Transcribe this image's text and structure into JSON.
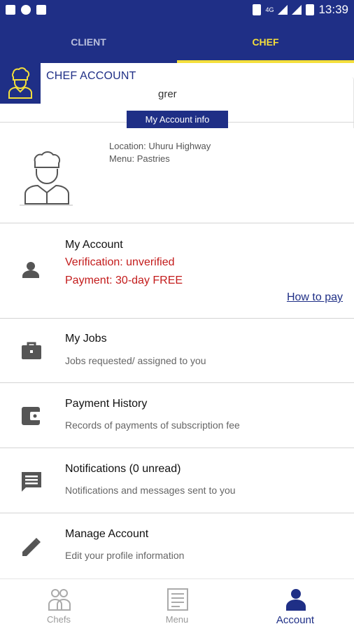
{
  "status_bar": {
    "time": "13:39",
    "network": "4G"
  },
  "tabs": [
    {
      "label": "CLIENT",
      "active": false
    },
    {
      "label": "CHEF",
      "active": true
    }
  ],
  "account_header": {
    "title": "CHEF ACCOUNT",
    "name": "grer",
    "info_button": "My Account info"
  },
  "profile": {
    "location": "Location: Uhuru Highway",
    "menu": "Menu: Pastries"
  },
  "my_account": {
    "title": "My Account",
    "verification": "Verification: unverified",
    "payment": "Payment: 30-day FREE",
    "how_to_pay": "How to pay"
  },
  "list": [
    {
      "title": "My Jobs",
      "subtitle": "Jobs requested/ assigned to you",
      "icon": "briefcase-icon"
    },
    {
      "title": "Payment History",
      "subtitle": "Records of payments of subscription fee",
      "icon": "wallet-icon"
    },
    {
      "title": "Notifications (0 unread)",
      "subtitle": "Notifications and messages sent to you",
      "icon": "message-icon"
    },
    {
      "title": "Manage Account",
      "subtitle": "Edit your profile information",
      "icon": "pencil-icon"
    }
  ],
  "bottom_nav": [
    {
      "label": "Chefs",
      "icon": "chefs-icon",
      "active": false
    },
    {
      "label": "Menu",
      "icon": "menu-icon",
      "active": false
    },
    {
      "label": "Account",
      "icon": "account-icon",
      "active": true
    }
  ],
  "colors": {
    "primary": "#1f2f86",
    "accent": "#f4df3b",
    "warning": "#c31b1b"
  }
}
